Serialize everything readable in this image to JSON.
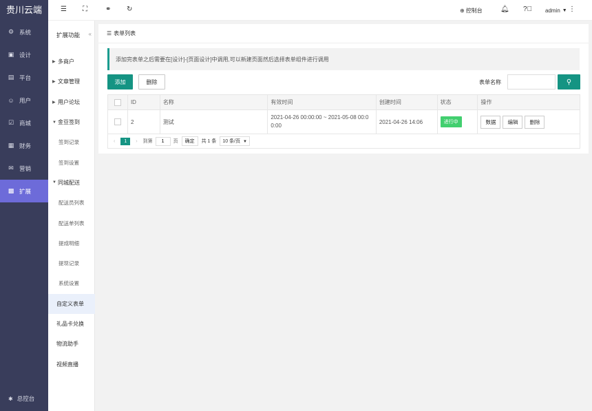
{
  "app": {
    "brand": "贵川云端"
  },
  "nav": {
    "items": [
      {
        "label": "系统",
        "icon": "gear-icon",
        "glyph": "⚙"
      },
      {
        "label": "设计",
        "icon": "design-icon",
        "glyph": "▣"
      },
      {
        "label": "平台",
        "icon": "platform-icon",
        "glyph": "▤"
      },
      {
        "label": "用户",
        "icon": "user-icon",
        "glyph": "☺"
      },
      {
        "label": "商城",
        "icon": "shop-icon",
        "glyph": "☑"
      },
      {
        "label": "财务",
        "icon": "finance-icon",
        "glyph": "▦"
      },
      {
        "label": "营销",
        "icon": "gift-icon",
        "glyph": "✉"
      },
      {
        "label": "扩展",
        "icon": "extend-icon",
        "glyph": "▩"
      }
    ],
    "bottom_label": "总控台"
  },
  "sub": {
    "title": "扩展功能",
    "items": [
      {
        "label": "多商户",
        "kind": "group"
      },
      {
        "label": "文章管理",
        "kind": "group"
      },
      {
        "label": "用户论坛",
        "kind": "group"
      },
      {
        "label": "金豆签到",
        "kind": "open"
      },
      {
        "label": "签到记录",
        "kind": "child"
      },
      {
        "label": "签到设置",
        "kind": "child"
      },
      {
        "label": "同城配送",
        "kind": "open"
      },
      {
        "label": "配送员列表",
        "kind": "child"
      },
      {
        "label": "配送单列表",
        "kind": "child"
      },
      {
        "label": "提成明细",
        "kind": "child"
      },
      {
        "label": "提现记录",
        "kind": "child"
      },
      {
        "label": "系统设置",
        "kind": "child"
      },
      {
        "label": "自定义表单",
        "kind": "plain-active"
      },
      {
        "label": "礼品卡兑换",
        "kind": "plain"
      },
      {
        "label": "物流助手",
        "kind": "plain"
      },
      {
        "label": "视频直播",
        "kind": "plain"
      }
    ]
  },
  "topbar": {
    "console_label": "控制台",
    "user_label": "admin"
  },
  "content": {
    "title": "表单列表",
    "notice": "添加完表单之后需要在[设计]-[页面设计]中调用,可以新建页面然后选择表单组件进行调用",
    "add_label": "添加",
    "delete_label": "删除",
    "search_label": "表单名称",
    "search_value": "",
    "columns": [
      "ID",
      "名称",
      "有效时间",
      "创建时间",
      "状态",
      "操作"
    ],
    "rows": [
      {
        "id": "2",
        "name": "测试",
        "valid_time": "2021-04-26 00:00:00 ~ 2021-05-08 00:00:00",
        "created": "2021-04-26 14:06",
        "status": "进行中",
        "ops": [
          "数据",
          "编辑",
          "删除"
        ]
      }
    ],
    "pager": {
      "current": "1",
      "goto_label": "到第",
      "page_value": "1",
      "page_unit": "页",
      "confirm": "确定",
      "total": "共 1 条",
      "size": "10 条/页"
    }
  }
}
